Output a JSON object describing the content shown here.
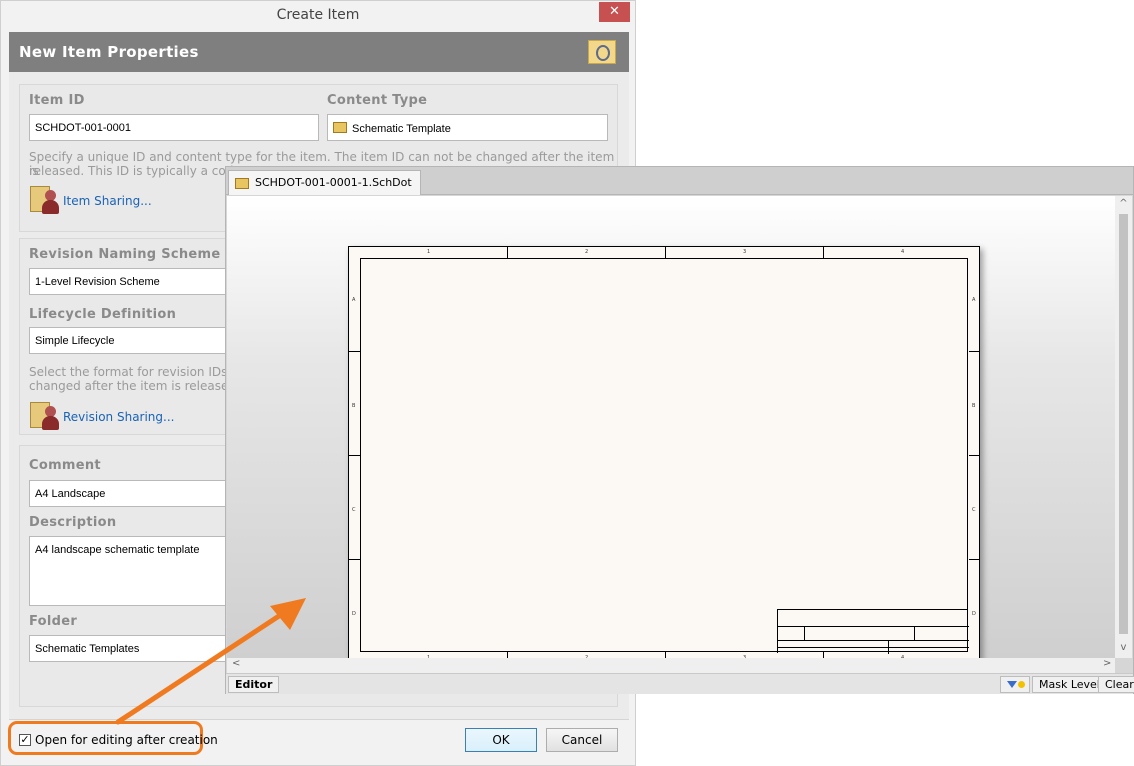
{
  "dialog": {
    "window_title": "Create Item",
    "close_glyph": "✕",
    "banner_title": "New Item Properties",
    "banner_icon": "item-properties-icon",
    "item_id_label": "Item ID",
    "item_id_value": "SCHDOT-001-0001",
    "content_type_label": "Content Type",
    "content_type_value": "Schematic Template",
    "content_type_icon": "schematic-template-icon",
    "id_help_line1": "Specify a unique ID and content type for the item. The item ID can not be changed after the item is",
    "id_help_line2": "released. This ID is typically a code,",
    "item_sharing_link": "Item Sharing...",
    "revision_scheme_label": "Revision Naming Scheme",
    "revision_scheme_value": "1-Level Revision Scheme",
    "lifecycle_label": "Lifecycle Definition",
    "lifecycle_value": "Simple Lifecycle",
    "revision_help_line1": "Select the format for revision IDs ar",
    "revision_help_line2": "changed after the item is released.",
    "revision_sharing_link": "Revision Sharing...",
    "comment_label": "Comment",
    "comment_value": "A4  Landscape",
    "description_label": "Description",
    "description_value": "A4 landscape schematic template",
    "folder_label": "Folder",
    "folder_value": "Schematic Templates",
    "open_editing_checked": true,
    "open_editing_label": "Open for editing after creation",
    "ok_label": "OK",
    "cancel_label": "Cancel"
  },
  "editor": {
    "tab_label": "SCHDOT-001-0001-1.SchDot",
    "tab_icon": "schdot-document-icon",
    "editor_button": "Editor",
    "mask_level_button": "Mask Level",
    "clear_button": "Clear",
    "filter_icon": "filter-icon",
    "scroll_up": "^",
    "scroll_down": "v",
    "scroll_left": "<",
    "scroll_right": ">",
    "zone_columns": [
      "1",
      "2",
      "3",
      "4"
    ],
    "zone_rows": [
      "A",
      "B",
      "C",
      "D"
    ]
  },
  "colors": {
    "highlight": "#f07a20",
    "banner": "#7f7f7f",
    "link": "#1a63b6"
  }
}
